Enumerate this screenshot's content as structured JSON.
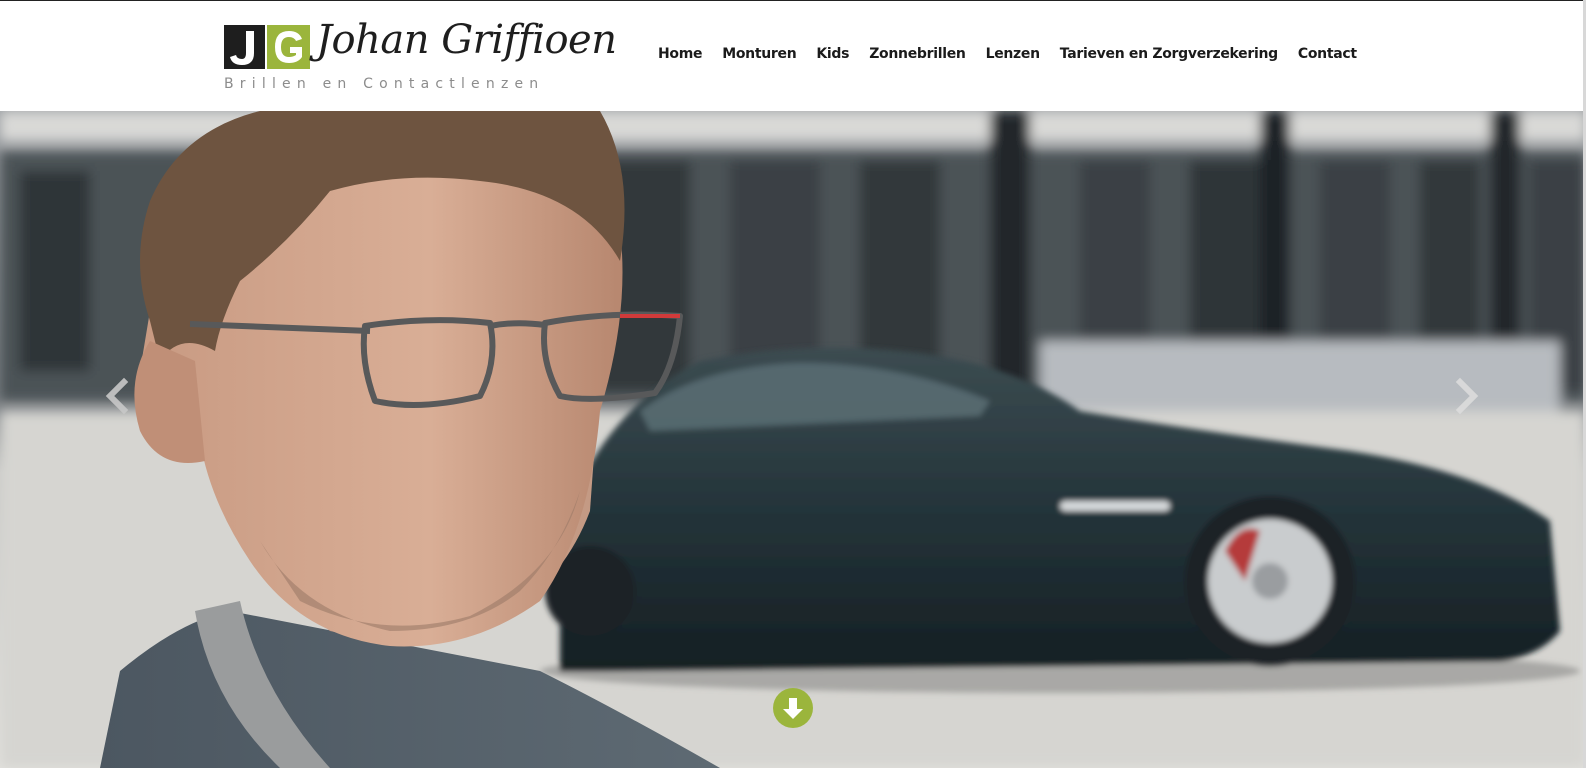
{
  "brand": {
    "initials": "JG",
    "name": "Johan Griffioen",
    "tagline": "Brillen en Contactlenzen",
    "accent_color": "#9bb53c",
    "dark_color": "#1e1e1e"
  },
  "nav": {
    "items": [
      {
        "label": "Home"
      },
      {
        "label": "Monturen"
      },
      {
        "label": "Kids"
      },
      {
        "label": "Zonnebrillen"
      },
      {
        "label": "Lenzen"
      },
      {
        "label": "Tarieven en Zorgverzekering"
      },
      {
        "label": "Contact"
      }
    ]
  },
  "hero": {
    "prev_icon": "chevron-left-icon",
    "next_icon": "chevron-right-icon",
    "scroll_icon": "arrow-down-icon"
  }
}
